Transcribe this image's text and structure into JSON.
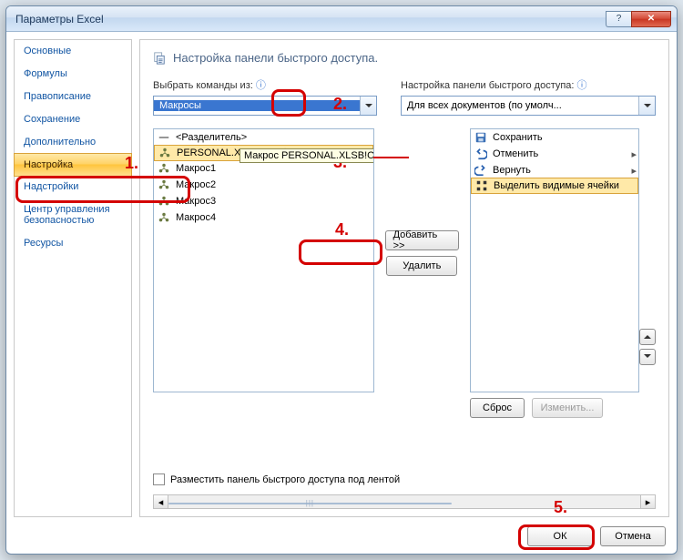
{
  "window": {
    "title": "Параметры Excel"
  },
  "sidebar": {
    "items": [
      {
        "label": "Основные"
      },
      {
        "label": "Формулы"
      },
      {
        "label": "Правописание"
      },
      {
        "label": "Сохранение"
      },
      {
        "label": "Дополнительно"
      },
      {
        "label": "Настройка"
      },
      {
        "label": "Надстройки"
      },
      {
        "label": "Центр управления безопасностью"
      },
      {
        "label": "Ресурсы"
      }
    ],
    "selected_index": 5
  },
  "main": {
    "heading": "Настройка панели быстрого доступа.",
    "choose_label": "Выбрать команды из:",
    "choose_value": "Макросы",
    "target_label": "Настройка панели быстрого доступа:",
    "target_value": "Для всех документов (по умолч...",
    "left_list": [
      {
        "label": "<Разделитель>",
        "icon": "separator"
      },
      {
        "label": "PERSONAL.XLSB!Отобрази...",
        "icon": "macro",
        "selected": true
      },
      {
        "label": "Макрос1",
        "icon": "macro"
      },
      {
        "label": "Макрос2",
        "icon": "macro"
      },
      {
        "label": "Макрос3",
        "icon": "macro"
      },
      {
        "label": "Макрос4",
        "icon": "macro"
      }
    ],
    "tooltip": "Макрос PERSONAL.XLSB!ОтобразитьЯрлычки",
    "right_list": [
      {
        "label": "Сохранить",
        "icon": "save"
      },
      {
        "label": "Отменить",
        "icon": "undo",
        "expand": true
      },
      {
        "label": "Вернуть",
        "icon": "redo",
        "expand": true
      },
      {
        "label": "Выделить видимые ячейки",
        "icon": "select-visible",
        "selected": true
      }
    ],
    "add_label": "Добавить >>",
    "remove_label": "Удалить",
    "reset_label": "Сброс",
    "modify_label": "Изменить...",
    "checkbox_label": "Разместить панель быстрого доступа под лентой"
  },
  "footer": {
    "ok": "ОК",
    "cancel": "Отмена"
  },
  "annotations": {
    "n1": "1.",
    "n2": "2.",
    "n3": "3.",
    "n4": "4.",
    "n5": "5."
  }
}
